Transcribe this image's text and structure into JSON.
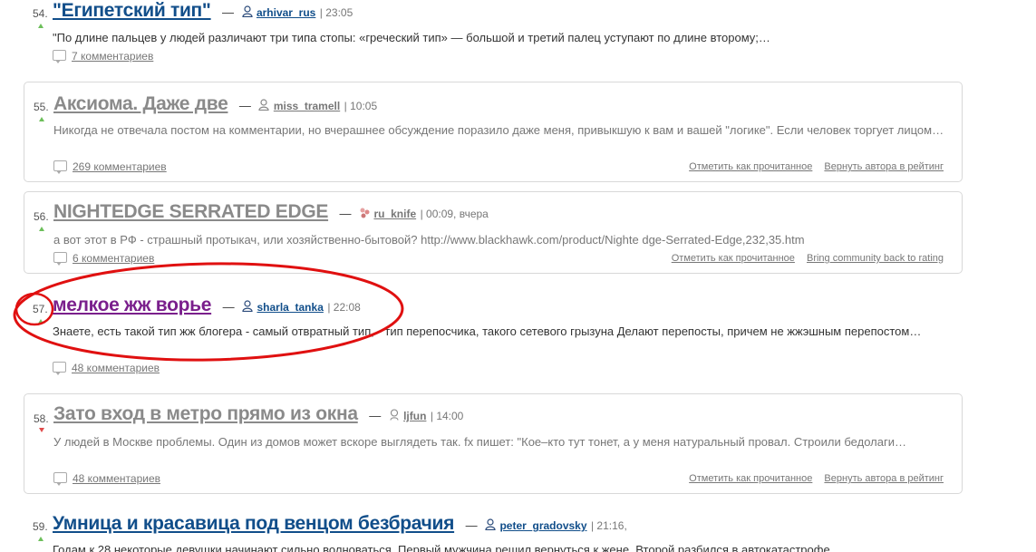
{
  "posts": [
    {
      "number": "54.",
      "vote": "up",
      "title": "\"Египетский тип\"",
      "author": "arhivar_rus",
      "time": "| 23:05",
      "excerpt": "\"По длине пальцев у людей различают три типа стопы: «греческий тип» — большой и третий палец уступают по длине второму;…",
      "comments": "7 комментариев"
    },
    {
      "number": "55.",
      "vote": "up",
      "title": "Аксиома. Даже две",
      "author": "miss_tramell",
      "time": "| 10:05",
      "excerpt": "Никогда не отвечала постом на комментарии, но вчерашнее обсуждение поразило даже меня, привыкшую к вам и вашей \"логике\". Если человек торгует лицом…",
      "comments": "269 комментариев",
      "action_read": "Отметить как прочитанное",
      "action_restore": "Вернуть автора в рейтинг"
    },
    {
      "number": "56.",
      "vote": "up",
      "title": "NIGHTEDGE SERRATED EDGE",
      "author": "ru_knife",
      "time": "| 00:09, вчера",
      "excerpt": "а вот этот в РФ - страшный протыкач, или хозяйственно-бытовой? http://www.blackhawk.com/product/Nighte dge-Serrated-Edge,232,35.htm",
      "comments": "6 комментариев",
      "action_read": "Отметить как прочитанное",
      "action_restore": "Bring community back to rating"
    },
    {
      "number": "57.",
      "vote": "up",
      "title": "мелкое жж ворье",
      "author": "sharla_tanka",
      "time": "| 22:08",
      "excerpt": "Знаете, есть такой тип жж блогера - самый отвратный тип, - тип перепосчика, такого сетевого грызуна Делают перепосты, причем не жжэшным перепостом…",
      "comments": "48 комментариев"
    },
    {
      "number": "58.",
      "vote": "down",
      "title": "Зато вход в метро прямо из окна",
      "author": "ljfun",
      "time": "| 14:00",
      "excerpt": "У людей в Москве проблемы. Один из домов может вскоре выглядеть так. fx пишет: \"Кое–кто тут тонет, а у меня натуральный провал. Строили бедолаги…",
      "comments": "48 комментариев",
      "action_read": "Отметить как прочитанное",
      "action_restore": "Вернуть автора в рейтинг"
    },
    {
      "number": "59.",
      "vote": "up",
      "title": "Умница и красавица под венцом безбрачия",
      "author": "peter_gradovsky",
      "time": "| 21:16,",
      "excerpt": "Годам к 28 некоторые девушки начинают сильно волноваться. Первый мужчина решил вернуться к жене. Второй разбился в автокатастрофе…"
    }
  ],
  "colors": {
    "link_blue": "#114e8a",
    "visited_purple": "#7a1f8c",
    "muted_gray": "#8a8a8a",
    "annotation_red": "#e01010",
    "vote_up": "#6cbf5a",
    "vote_down": "#e04a4a"
  }
}
